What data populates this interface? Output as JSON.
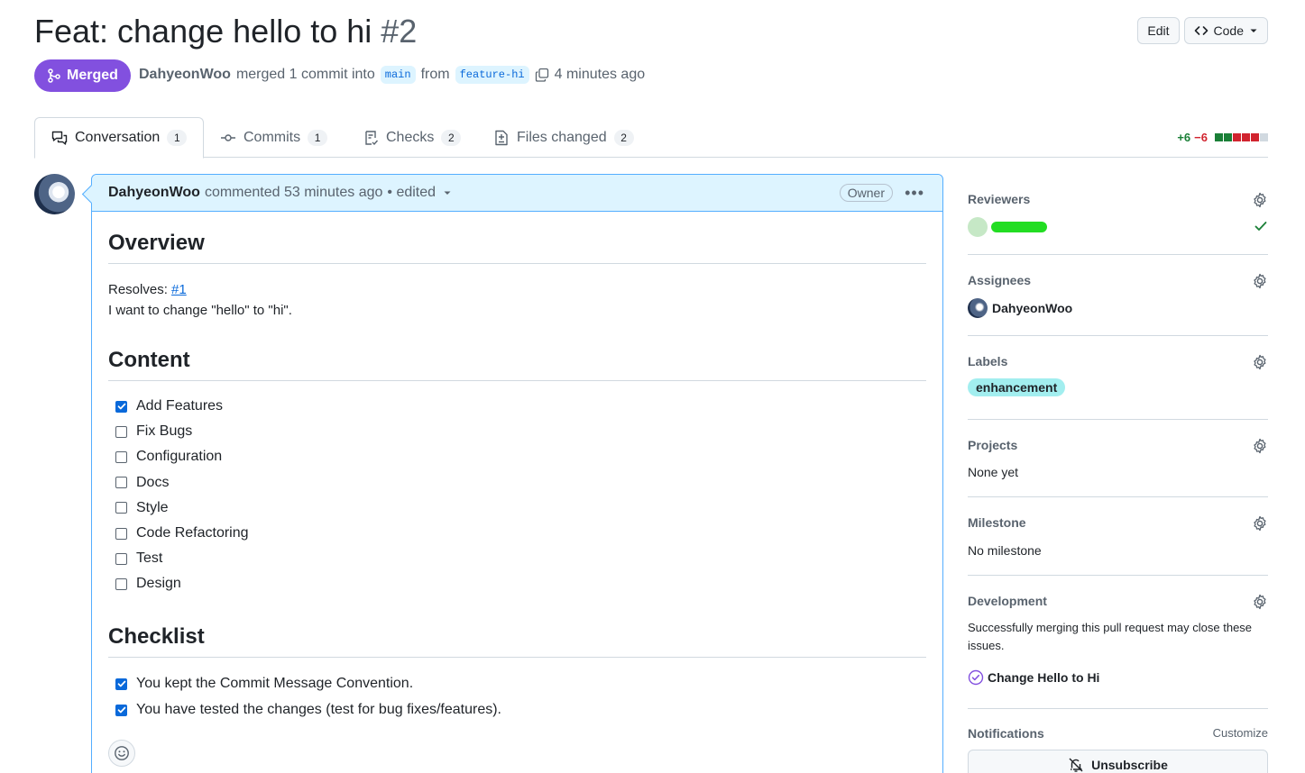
{
  "header": {
    "title": "Feat: change hello to hi",
    "number": "#2",
    "edit_label": "Edit",
    "code_label": "Code"
  },
  "state": {
    "badge": "Merged",
    "author": "DahyeonWoo",
    "merged_text": "merged 1 commit into",
    "base_branch": "main",
    "from_text": "from",
    "head_branch": "feature-hi",
    "time": "4 minutes ago"
  },
  "tabs": [
    {
      "label": "Conversation",
      "count": "1"
    },
    {
      "label": "Commits",
      "count": "1"
    },
    {
      "label": "Checks",
      "count": "2"
    },
    {
      "label": "Files changed",
      "count": "2"
    }
  ],
  "diffstat": {
    "additions": "+6",
    "deletions": "−6",
    "blocks": [
      "#1a7f37",
      "#1a7f37",
      "#d1242f",
      "#d1242f",
      "#d1242f",
      "#d1d9e0"
    ]
  },
  "comment": {
    "author": "DahyeonWoo",
    "action": "commented 53 minutes ago",
    "edited": "• edited",
    "role": "Owner",
    "overview_heading": "Overview",
    "resolves_label": "Resolves:",
    "resolves_link": "#1",
    "description": "I want to change \"hello\" to \"hi\".",
    "content_heading": "Content",
    "content_tasks": [
      {
        "label": "Add Features",
        "checked": true
      },
      {
        "label": "Fix Bugs",
        "checked": false
      },
      {
        "label": "Configuration",
        "checked": false
      },
      {
        "label": "Docs",
        "checked": false
      },
      {
        "label": "Style",
        "checked": false
      },
      {
        "label": "Code Refactoring",
        "checked": false
      },
      {
        "label": "Test",
        "checked": false
      },
      {
        "label": "Design",
        "checked": false
      }
    ],
    "checklist_heading": "Checklist",
    "checklist_tasks": [
      {
        "label": "You kept the Commit Message Convention.",
        "checked": true
      },
      {
        "label": "You have tested the changes (test for bug fixes/features).",
        "checked": true
      }
    ]
  },
  "sidebar": {
    "reviewers": {
      "title": "Reviewers",
      "status_icon": "check-icon"
    },
    "assignees": {
      "title": "Assignees",
      "name": "DahyeonWoo"
    },
    "labels": {
      "title": "Labels",
      "label": "enhancement"
    },
    "projects": {
      "title": "Projects",
      "value": "None yet"
    },
    "milestone": {
      "title": "Milestone",
      "value": "No milestone"
    },
    "development": {
      "title": "Development",
      "text": "Successfully merging this pull request may close these issues.",
      "issue": "Change Hello to Hi"
    },
    "notifications": {
      "title": "Notifications",
      "customize": "Customize",
      "button": "Unsubscribe"
    }
  }
}
